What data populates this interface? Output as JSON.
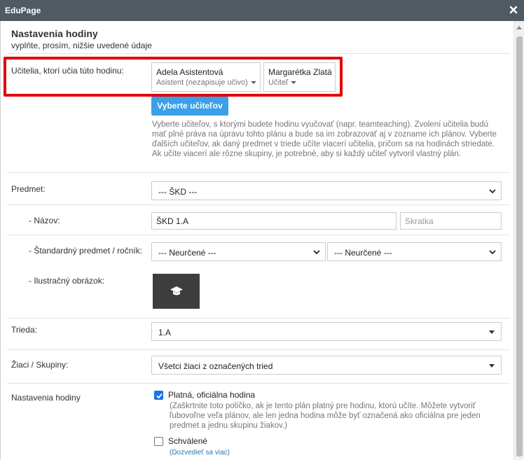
{
  "window": {
    "title": "EduPage"
  },
  "header": {
    "title": "Nastavenia hodiny",
    "subtitle": "vyplňte, prosím, nižšie uvedené údaje"
  },
  "teachers": {
    "label": "Učitelia, ktorí učia túto hodinu:",
    "items": [
      {
        "name": "Adela Asistentová",
        "role": "Asistent (nezapisuje učivo)"
      },
      {
        "name": "Margarétka Zlatá",
        "role": "Učiteľ"
      }
    ],
    "select_button": "Vyberte učiteľov",
    "help": "Vyberte učiteľov, s ktorými budete hodinu vyučovať (napr. teamteaching). Zvolení učitelia budú mať plné práva na úpravu tohto plánu a bude sa im zobrazovať aj v zozname ich plánov. Vyberte ďalších učiteľov, ak daný predmet v triede učíte viacerí učitelia, pričom sa na hodinách striedate. Ak učíte viacerí ale rôzne skupiny, je potrebné, aby si každý učiteľ vytvoril vlastný plán."
  },
  "subject": {
    "label": "Predmet:",
    "value": "--- ŠKD ---"
  },
  "name": {
    "label": "- Názov:",
    "value": "ŠKD 1.A",
    "short_placeholder": "Skratka"
  },
  "standard": {
    "label": "- Štandardný predmet / ročník:",
    "subject_value": "--- Neurčené ---",
    "grade_value": "--- Neurčené ---"
  },
  "image": {
    "label": "- Ilustračný obrázok:",
    "icon": "graduation-cap-icon"
  },
  "class": {
    "label": "Trieda:",
    "value": "1.A"
  },
  "students": {
    "label": "Žiaci / Skupiny:",
    "value": "Všetci žiaci z označených tried"
  },
  "settings": {
    "label": "Nastavenia hodiny",
    "official": {
      "label": "Platná, oficiálna hodina",
      "checked": true,
      "help": "(Zaškrtnite toto políčko, ak je tento plán platný pre hodinu, ktorú učíte. Môžete vytvoriť ľubovoľne veľa plánov, ale len jedna hodina môže byť označená ako oficiálna pre jeden predmet a jednu skupinu žiakov.)"
    },
    "approved": {
      "label": "Schválené",
      "checked": false
    },
    "learn_more": "(Dozvedieť sa viac)"
  },
  "colors": {
    "titlebar": "#4f5a63",
    "primary_button": "#3aa0e8",
    "highlight": "#e50000",
    "checkbox": "#1a73e8",
    "link": "#2a7ab0"
  }
}
